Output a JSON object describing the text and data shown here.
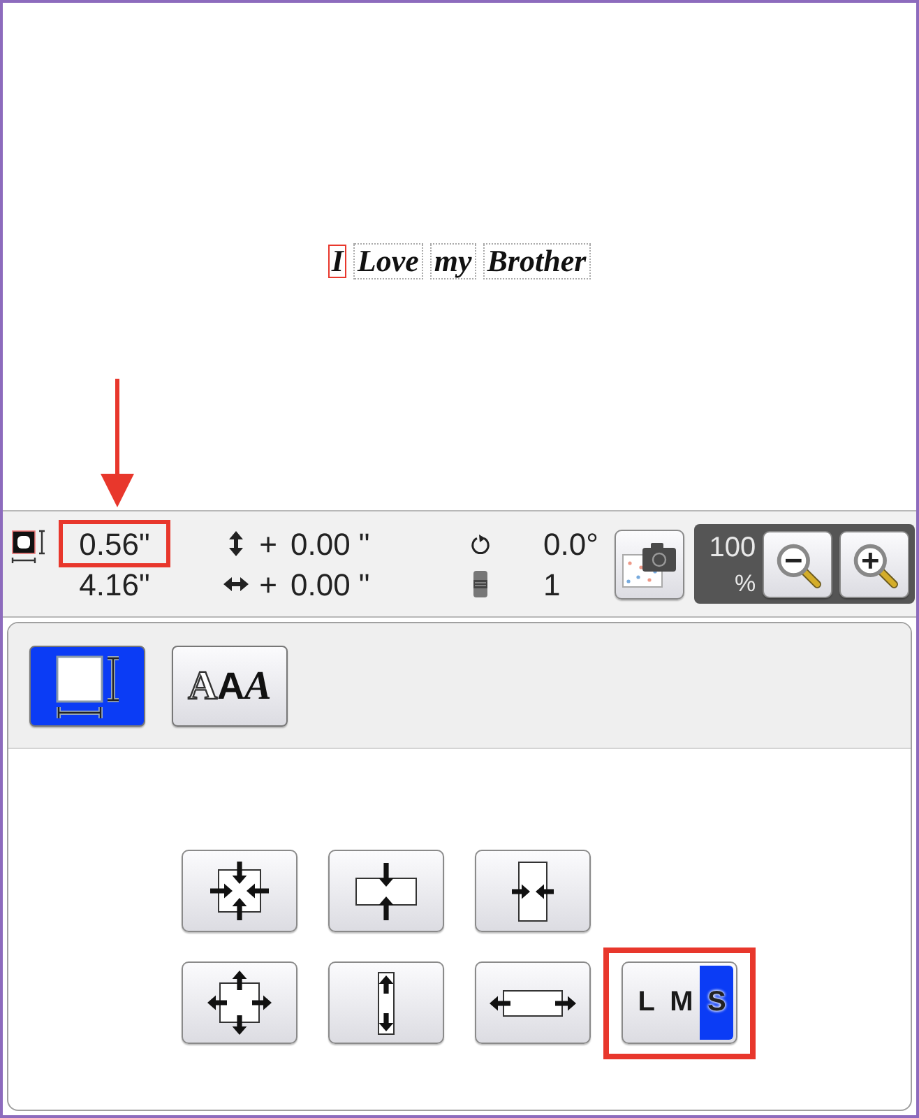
{
  "canvas": {
    "words": [
      {
        "text": "I",
        "selected": true
      },
      {
        "text": "Love",
        "selected": false
      },
      {
        "text": "my",
        "selected": false
      },
      {
        "text": "Brother",
        "selected": false
      }
    ]
  },
  "info_bar": {
    "size": {
      "height": {
        "value": "0.56\"",
        "highlighted": true,
        "arrow": true
      },
      "width": {
        "value": "4.16\"",
        "highlighted": false,
        "arrow": false
      }
    },
    "position": {
      "vertical": {
        "sign": "+",
        "value": "0.00 \""
      },
      "horizontal": {
        "sign": "+",
        "value": "0.00 \""
      }
    },
    "rotation": "0.0°",
    "thread_count": "1",
    "zoom": {
      "value": "100",
      "unit": "%"
    }
  },
  "edit_panel": {
    "tabs": [
      {
        "kind": "size",
        "selected": true
      },
      {
        "kind": "font",
        "selected": false,
        "glyphs": [
          {
            "text": "A",
            "kind": "outline"
          },
          {
            "text": "A",
            "kind": "bold"
          },
          {
            "text": "A",
            "kind": "script"
          }
        ]
      }
    ],
    "button_rows": [
      [
        {
          "kind": "shrink_all"
        },
        {
          "kind": "shrink_height"
        },
        {
          "kind": "shrink_width"
        }
      ],
      [
        {
          "kind": "enlarge_all"
        },
        {
          "kind": "enlarge_height"
        },
        {
          "kind": "enlarge_width"
        }
      ]
    ],
    "size_presets": {
      "highlighted": true,
      "options": [
        {
          "label": "L",
          "selected": false
        },
        {
          "label": "M",
          "selected": false
        },
        {
          "label": "S",
          "selected": true
        }
      ]
    }
  }
}
